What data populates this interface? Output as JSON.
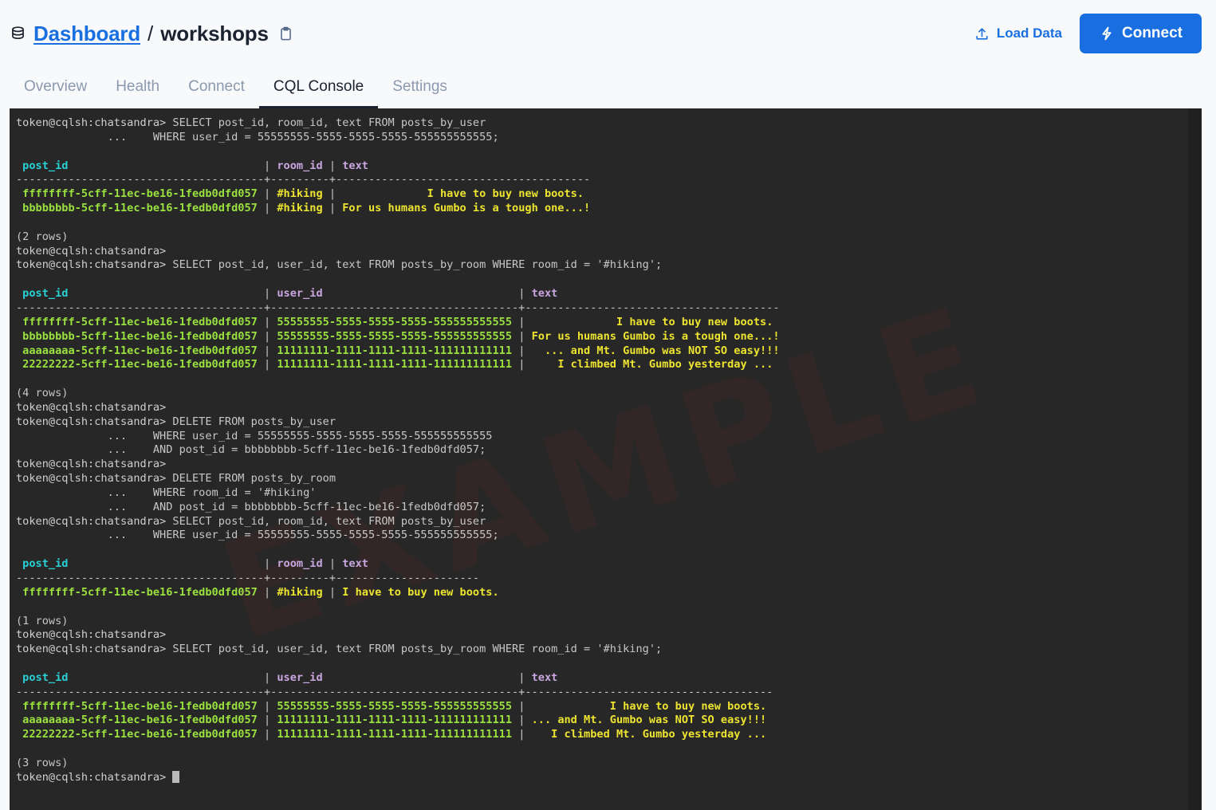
{
  "header": {
    "db_icon": "database-icon",
    "breadcrumb_link": "Dashboard",
    "breadcrumb_separator": "/",
    "breadcrumb_current": "workshops",
    "copy_icon": "clipboard-icon",
    "load_data_label": "Load Data",
    "load_data_icon": "upload-icon",
    "connect_label": "Connect",
    "connect_icon": "lightning-bolt-icon",
    "accent_color": "#1a6fe0"
  },
  "tabs": [
    {
      "label": "Overview",
      "active": false
    },
    {
      "label": "Health",
      "active": false
    },
    {
      "label": "Connect",
      "active": false
    },
    {
      "label": "CQL Console",
      "active": true
    },
    {
      "label": "Settings",
      "active": false
    }
  ],
  "terminal": {
    "background_color": "#272727",
    "watermark_text": "EXAMPLE",
    "prompt": "token@cqlsh:chatsandra>",
    "cursor": "block-cursor",
    "colors": {
      "prompt": "#cfcfcf",
      "header_key": "#29d0d6",
      "header_other": "#c9a6e0",
      "uuid": "#9ae13f",
      "value": "#ece430",
      "rule": "#c9c9c9"
    },
    "lines": [
      {
        "segments": [
          {
            "t": "token@cqlsh:chatsandra> ",
            "c": "c-prompt"
          },
          {
            "t": "SELECT post_id, room_id, text FROM posts_by_user",
            "c": "c-dim"
          }
        ]
      },
      {
        "segments": [
          {
            "t": "              ...    WHERE user_id = 55555555-5555-5555-5555-555555555555;",
            "c": "c-dim"
          }
        ]
      },
      {
        "segments": [
          {
            "t": "",
            "c": "c-dim"
          }
        ]
      },
      {
        "segments": [
          {
            "t": " post_id                              ",
            "c": "c-head-cyan"
          },
          {
            "t": "| ",
            "c": "c-rule"
          },
          {
            "t": "room_id ",
            "c": "c-head-purple"
          },
          {
            "t": "| ",
            "c": "c-rule"
          },
          {
            "t": "text",
            "c": "c-head-purple"
          }
        ]
      },
      {
        "segments": [
          {
            "t": "--------------------------------------+---------+---------------------------------------",
            "c": "c-rule"
          }
        ]
      },
      {
        "segments": [
          {
            "t": " ffffffff-5cff-11ec-be16-1fedb0dfd057 ",
            "c": "c-green"
          },
          {
            "t": "| ",
            "c": "c-rule"
          },
          {
            "t": "#hiking ",
            "c": "c-yellow"
          },
          {
            "t": "| ",
            "c": "c-rule"
          },
          {
            "t": "             I have to buy new boots.",
            "c": "c-yellow"
          }
        ]
      },
      {
        "segments": [
          {
            "t": " bbbbbbbb-5cff-11ec-be16-1fedb0dfd057 ",
            "c": "c-green"
          },
          {
            "t": "| ",
            "c": "c-rule"
          },
          {
            "t": "#hiking ",
            "c": "c-yellow"
          },
          {
            "t": "| ",
            "c": "c-rule"
          },
          {
            "t": "For us humans Gumbo is a tough one...!",
            "c": "c-yellow"
          }
        ]
      },
      {
        "segments": [
          {
            "t": "",
            "c": "c-dim"
          }
        ]
      },
      {
        "segments": [
          {
            "t": "(2 rows)",
            "c": "c-dim"
          }
        ]
      },
      {
        "segments": [
          {
            "t": "token@cqlsh:chatsandra>",
            "c": "c-prompt"
          }
        ]
      },
      {
        "segments": [
          {
            "t": "token@cqlsh:chatsandra> ",
            "c": "c-prompt"
          },
          {
            "t": "SELECT post_id, user_id, text FROM posts_by_room WHERE room_id = '#hiking';",
            "c": "c-dim"
          }
        ]
      },
      {
        "segments": [
          {
            "t": "",
            "c": "c-dim"
          }
        ]
      },
      {
        "segments": [
          {
            "t": " post_id                              ",
            "c": "c-head-cyan"
          },
          {
            "t": "| ",
            "c": "c-rule"
          },
          {
            "t": "user_id                              ",
            "c": "c-head-purple"
          },
          {
            "t": "| ",
            "c": "c-rule"
          },
          {
            "t": "text",
            "c": "c-head-purple"
          }
        ]
      },
      {
        "segments": [
          {
            "t": "--------------------------------------+--------------------------------------+---------------------------------------",
            "c": "c-rule"
          }
        ]
      },
      {
        "segments": [
          {
            "t": " ffffffff-5cff-11ec-be16-1fedb0dfd057 ",
            "c": "c-green"
          },
          {
            "t": "| ",
            "c": "c-rule"
          },
          {
            "t": "55555555-5555-5555-5555-555555555555 ",
            "c": "c-green"
          },
          {
            "t": "| ",
            "c": "c-rule"
          },
          {
            "t": "             I have to buy new boots.",
            "c": "c-yellow"
          }
        ]
      },
      {
        "segments": [
          {
            "t": " bbbbbbbb-5cff-11ec-be16-1fedb0dfd057 ",
            "c": "c-green"
          },
          {
            "t": "| ",
            "c": "c-rule"
          },
          {
            "t": "55555555-5555-5555-5555-555555555555 ",
            "c": "c-green"
          },
          {
            "t": "| ",
            "c": "c-rule"
          },
          {
            "t": "For us humans Gumbo is a tough one...!",
            "c": "c-yellow"
          }
        ]
      },
      {
        "segments": [
          {
            "t": " aaaaaaaa-5cff-11ec-be16-1fedb0dfd057 ",
            "c": "c-green"
          },
          {
            "t": "| ",
            "c": "c-rule"
          },
          {
            "t": "11111111-1111-1111-1111-111111111111 ",
            "c": "c-green"
          },
          {
            "t": "| ",
            "c": "c-rule"
          },
          {
            "t": "  ... and Mt. Gumbo was NOT SO easy!!!",
            "c": "c-yellow"
          }
        ]
      },
      {
        "segments": [
          {
            "t": " 22222222-5cff-11ec-be16-1fedb0dfd057 ",
            "c": "c-green"
          },
          {
            "t": "| ",
            "c": "c-rule"
          },
          {
            "t": "11111111-1111-1111-1111-111111111111 ",
            "c": "c-green"
          },
          {
            "t": "| ",
            "c": "c-rule"
          },
          {
            "t": "    I climbed Mt. Gumbo yesterday ...",
            "c": "c-yellow"
          }
        ]
      },
      {
        "segments": [
          {
            "t": "",
            "c": "c-dim"
          }
        ]
      },
      {
        "segments": [
          {
            "t": "(4 rows)",
            "c": "c-dim"
          }
        ]
      },
      {
        "segments": [
          {
            "t": "token@cqlsh:chatsandra>",
            "c": "c-prompt"
          }
        ]
      },
      {
        "segments": [
          {
            "t": "token@cqlsh:chatsandra> ",
            "c": "c-prompt"
          },
          {
            "t": "DELETE FROM posts_by_user",
            "c": "c-dim"
          }
        ]
      },
      {
        "segments": [
          {
            "t": "              ...    WHERE user_id = 55555555-5555-5555-5555-555555555555",
            "c": "c-dim"
          }
        ]
      },
      {
        "segments": [
          {
            "t": "              ...    AND post_id = bbbbbbbb-5cff-11ec-be16-1fedb0dfd057;",
            "c": "c-dim"
          }
        ]
      },
      {
        "segments": [
          {
            "t": "token@cqlsh:chatsandra>",
            "c": "c-prompt"
          }
        ]
      },
      {
        "segments": [
          {
            "t": "token@cqlsh:chatsandra> ",
            "c": "c-prompt"
          },
          {
            "t": "DELETE FROM posts_by_room",
            "c": "c-dim"
          }
        ]
      },
      {
        "segments": [
          {
            "t": "              ...    WHERE room_id = '#hiking'",
            "c": "c-dim"
          }
        ]
      },
      {
        "segments": [
          {
            "t": "              ...    AND post_id = bbbbbbbb-5cff-11ec-be16-1fedb0dfd057;",
            "c": "c-dim"
          }
        ]
      },
      {
        "segments": [
          {
            "t": "token@cqlsh:chatsandra> ",
            "c": "c-prompt"
          },
          {
            "t": "SELECT post_id, room_id, text FROM posts_by_user",
            "c": "c-dim"
          }
        ]
      },
      {
        "segments": [
          {
            "t": "              ...    WHERE user_id = 55555555-5555-5555-5555-555555555555;",
            "c": "c-dim"
          }
        ]
      },
      {
        "segments": [
          {
            "t": "",
            "c": "c-dim"
          }
        ]
      },
      {
        "segments": [
          {
            "t": " post_id                              ",
            "c": "c-head-cyan"
          },
          {
            "t": "| ",
            "c": "c-rule"
          },
          {
            "t": "room_id ",
            "c": "c-head-purple"
          },
          {
            "t": "| ",
            "c": "c-rule"
          },
          {
            "t": "text",
            "c": "c-head-purple"
          }
        ]
      },
      {
        "segments": [
          {
            "t": "--------------------------------------+---------+----------------------",
            "c": "c-rule"
          }
        ]
      },
      {
        "segments": [
          {
            "t": " ffffffff-5cff-11ec-be16-1fedb0dfd057 ",
            "c": "c-green"
          },
          {
            "t": "| ",
            "c": "c-rule"
          },
          {
            "t": "#hiking ",
            "c": "c-yellow"
          },
          {
            "t": "| ",
            "c": "c-rule"
          },
          {
            "t": "I have to buy new boots.",
            "c": "c-yellow"
          }
        ]
      },
      {
        "segments": [
          {
            "t": "",
            "c": "c-dim"
          }
        ]
      },
      {
        "segments": [
          {
            "t": "(1 rows)",
            "c": "c-dim"
          }
        ]
      },
      {
        "segments": [
          {
            "t": "token@cqlsh:chatsandra>",
            "c": "c-prompt"
          }
        ]
      },
      {
        "segments": [
          {
            "t": "token@cqlsh:chatsandra> ",
            "c": "c-prompt"
          },
          {
            "t": "SELECT post_id, user_id, text FROM posts_by_room WHERE room_id = '#hiking';",
            "c": "c-dim"
          }
        ]
      },
      {
        "segments": [
          {
            "t": "",
            "c": "c-dim"
          }
        ]
      },
      {
        "segments": [
          {
            "t": " post_id                              ",
            "c": "c-head-cyan"
          },
          {
            "t": "| ",
            "c": "c-rule"
          },
          {
            "t": "user_id                              ",
            "c": "c-head-purple"
          },
          {
            "t": "| ",
            "c": "c-rule"
          },
          {
            "t": "text",
            "c": "c-head-purple"
          }
        ]
      },
      {
        "segments": [
          {
            "t": "--------------------------------------+--------------------------------------+--------------------------------------",
            "c": "c-rule"
          }
        ]
      },
      {
        "segments": [
          {
            "t": " ffffffff-5cff-11ec-be16-1fedb0dfd057 ",
            "c": "c-green"
          },
          {
            "t": "| ",
            "c": "c-rule"
          },
          {
            "t": "55555555-5555-5555-5555-555555555555 ",
            "c": "c-green"
          },
          {
            "t": "| ",
            "c": "c-rule"
          },
          {
            "t": "            I have to buy new boots.",
            "c": "c-yellow"
          }
        ]
      },
      {
        "segments": [
          {
            "t": " aaaaaaaa-5cff-11ec-be16-1fedb0dfd057 ",
            "c": "c-green"
          },
          {
            "t": "| ",
            "c": "c-rule"
          },
          {
            "t": "11111111-1111-1111-1111-111111111111 ",
            "c": "c-green"
          },
          {
            "t": "| ",
            "c": "c-rule"
          },
          {
            "t": "... and Mt. Gumbo was NOT SO easy!!!",
            "c": "c-yellow"
          }
        ]
      },
      {
        "segments": [
          {
            "t": " 22222222-5cff-11ec-be16-1fedb0dfd057 ",
            "c": "c-green"
          },
          {
            "t": "| ",
            "c": "c-rule"
          },
          {
            "t": "11111111-1111-1111-1111-111111111111 ",
            "c": "c-green"
          },
          {
            "t": "| ",
            "c": "c-rule"
          },
          {
            "t": "   I climbed Mt. Gumbo yesterday ...",
            "c": "c-yellow"
          }
        ]
      },
      {
        "segments": [
          {
            "t": "",
            "c": "c-dim"
          }
        ]
      },
      {
        "segments": [
          {
            "t": "(3 rows)",
            "c": "c-dim"
          }
        ]
      }
    ],
    "last_line_prompt": "token@cqlsh:chatsandra> "
  }
}
